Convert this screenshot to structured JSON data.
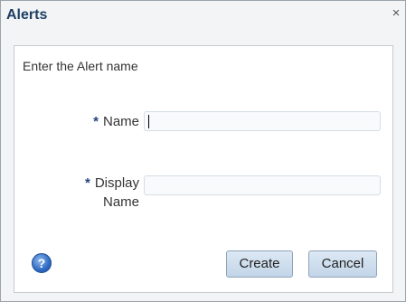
{
  "dialog": {
    "title": "Alerts",
    "close_glyph": "×",
    "prompt": "Enter the Alert name",
    "fields": {
      "name": {
        "required_marker": "*",
        "label": "Name",
        "value": ""
      },
      "display_name": {
        "required_marker": "*",
        "label_line1": "Display",
        "label_line2": "Name",
        "value": ""
      }
    },
    "help_glyph": "?",
    "buttons": {
      "create": "Create",
      "cancel": "Cancel"
    }
  },
  "colors": {
    "title": "#1c3f63",
    "required_marker": "#21447a",
    "button_top": "#dce8f4",
    "button_bottom": "#c2d5e8"
  },
  "icons": {
    "close": "close-icon",
    "help": "help-icon"
  }
}
